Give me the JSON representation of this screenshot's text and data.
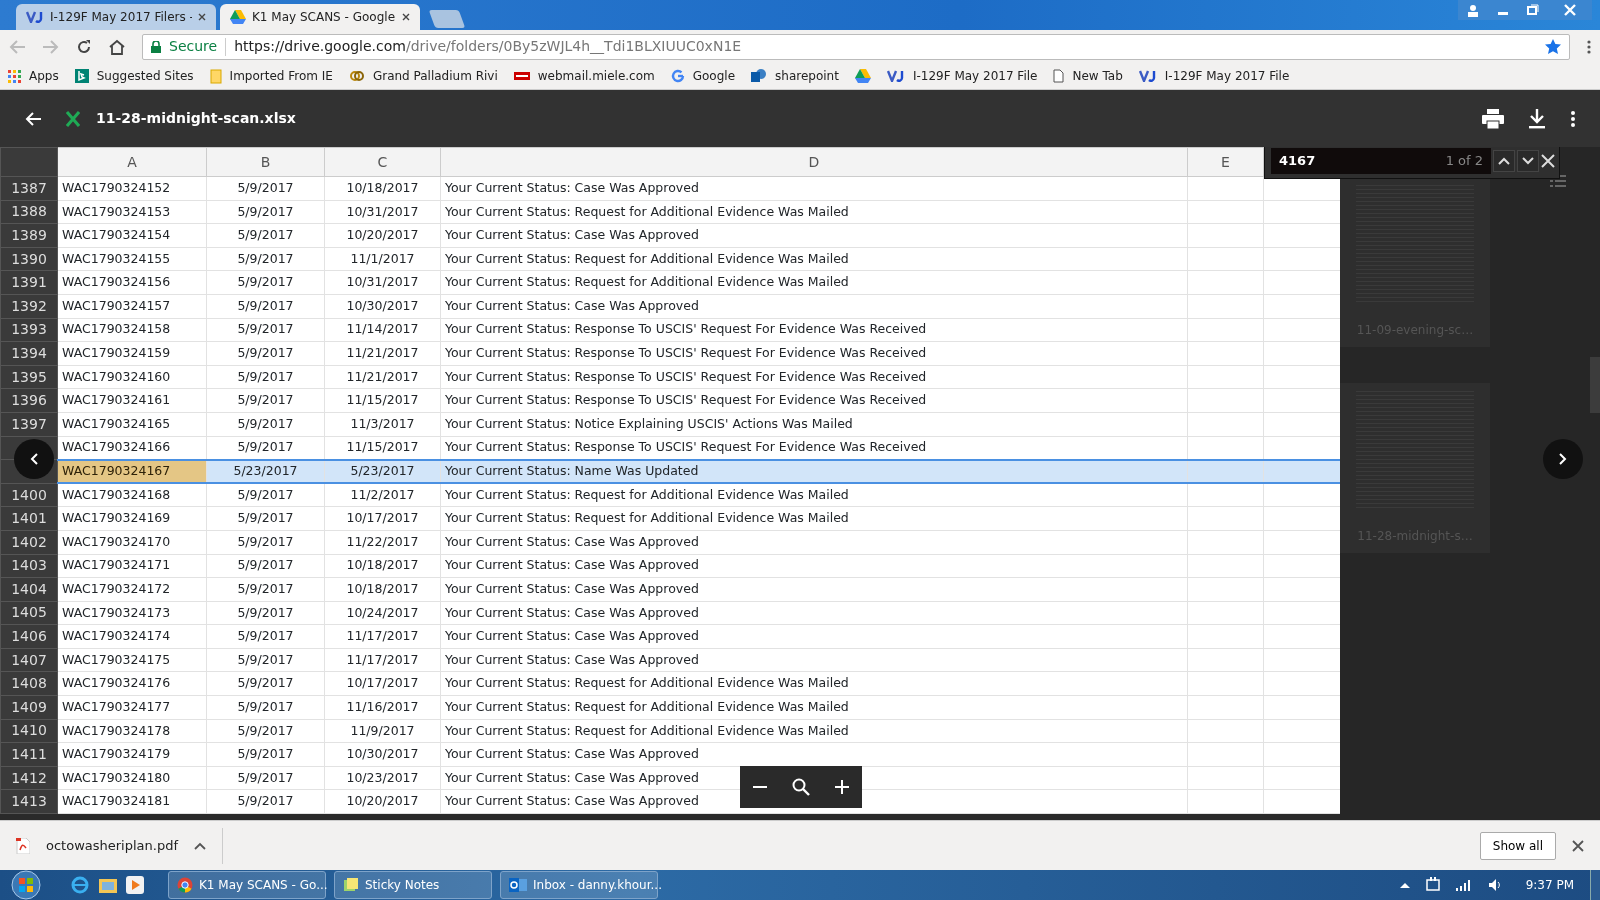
{
  "browser": {
    "tabs": [
      {
        "title": "I-129F May 2017 Filers -",
        "kind": "vj",
        "selected": false
      },
      {
        "title": "K1 May SCANS - Google",
        "kind": "drive",
        "selected": true
      }
    ],
    "secure_label": "Secure",
    "url_host": "https://drive.google.com",
    "url_path": "/drive/folders/0By5zWJL4h__Tdi1BLXIUUC0xN1E",
    "bookmarks": [
      {
        "label": "Apps",
        "kind": "apps"
      },
      {
        "label": "Suggested Sites",
        "kind": "bing"
      },
      {
        "label": "Imported From IE",
        "kind": "folder"
      },
      {
        "label": "Grand Palladium Rivi",
        "kind": "rings"
      },
      {
        "label": "webmail.miele.com",
        "kind": "miele"
      },
      {
        "label": "Google",
        "kind": "google"
      },
      {
        "label": "sharepoint",
        "kind": "sp"
      },
      {
        "kind": "drive"
      },
      {
        "label": "I-129F May 2017 File",
        "kind": "vj"
      },
      {
        "label": "New Tab",
        "kind": "page"
      },
      {
        "label": "I-129F May 2017 File",
        "kind": "vj"
      }
    ]
  },
  "viewer": {
    "file_name": "11-28-midnight-scan.xlsx",
    "find": {
      "query": "4167",
      "count": "1 of 2"
    },
    "thumbnails": [
      {
        "caption": "11-09-evening-sc…"
      },
      {
        "caption": "11-28-midnight-s…"
      }
    ]
  },
  "sheet": {
    "columns": [
      "A",
      "B",
      "C",
      "D",
      "E"
    ],
    "rows": [
      {
        "num": "1387",
        "a": "WAC1790324152",
        "b": "5/9/2017",
        "c": "10/18/2017",
        "d": "Your Current Status: Case Was Approved",
        "selected": false,
        "match": false
      },
      {
        "num": "1388",
        "a": "WAC1790324153",
        "b": "5/9/2017",
        "c": "10/31/2017",
        "d": "Your Current Status: Request for Additional Evidence Was Mailed",
        "selected": false,
        "match": false
      },
      {
        "num": "1389",
        "a": "WAC1790324154",
        "b": "5/9/2017",
        "c": "10/20/2017",
        "d": "Your Current Status: Case Was Approved",
        "selected": false,
        "match": false
      },
      {
        "num": "1390",
        "a": "WAC1790324155",
        "b": "5/9/2017",
        "c": "11/1/2017",
        "d": "Your Current Status: Request for Additional Evidence Was Mailed",
        "selected": false,
        "match": false
      },
      {
        "num": "1391",
        "a": "WAC1790324156",
        "b": "5/9/2017",
        "c": "10/31/2017",
        "d": "Your Current Status: Request for Additional Evidence Was Mailed",
        "selected": false,
        "match": false
      },
      {
        "num": "1392",
        "a": "WAC1790324157",
        "b": "5/9/2017",
        "c": "10/30/2017",
        "d": "Your Current Status: Case Was Approved",
        "selected": false,
        "match": false
      },
      {
        "num": "1393",
        "a": "WAC1790324158",
        "b": "5/9/2017",
        "c": "11/14/2017",
        "d": "Your Current Status: Response To USCIS' Request For Evidence Was Received",
        "selected": false,
        "match": false
      },
      {
        "num": "1394",
        "a": "WAC1790324159",
        "b": "5/9/2017",
        "c": "11/21/2017",
        "d": "Your Current Status: Response To USCIS' Request For Evidence Was Received",
        "selected": false,
        "match": false
      },
      {
        "num": "1395",
        "a": "WAC1790324160",
        "b": "5/9/2017",
        "c": "11/21/2017",
        "d": "Your Current Status: Response To USCIS' Request For Evidence Was Received",
        "selected": false,
        "match": false
      },
      {
        "num": "1396",
        "a": "WAC1790324161",
        "b": "5/9/2017",
        "c": "11/15/2017",
        "d": "Your Current Status: Response To USCIS' Request For Evidence Was Received",
        "selected": false,
        "match": false
      },
      {
        "num": "1397",
        "a": "WAC1790324165",
        "b": "5/9/2017",
        "c": "11/3/2017",
        "d": "Your Current Status: Notice Explaining USCIS' Actions Was Mailed",
        "selected": false,
        "match": false
      },
      {
        "a": "WAC1790324166",
        "b": "5/9/2017",
        "c": "11/15/2017",
        "d": "Your Current Status: Response To USCIS' Request For Evidence Was Received",
        "selected": false,
        "match": false
      },
      {
        "a": "WAC1790324167",
        "b": "5/23/2017",
        "c": "5/23/2017",
        "d": "Your Current Status: Name Was Updated",
        "selected": true,
        "match": true
      },
      {
        "num": "1400",
        "a": "WAC1790324168",
        "b": "5/9/2017",
        "c": "11/2/2017",
        "d": "Your Current Status: Request for Additional Evidence Was Mailed",
        "selected": false,
        "match": false
      },
      {
        "num": "1401",
        "a": "WAC1790324169",
        "b": "5/9/2017",
        "c": "10/17/2017",
        "d": "Your Current Status: Request for Additional Evidence Was Mailed",
        "selected": false,
        "match": false
      },
      {
        "num": "1402",
        "a": "WAC1790324170",
        "b": "5/9/2017",
        "c": "11/22/2017",
        "d": "Your Current Status: Case Was Approved",
        "selected": false,
        "match": false
      },
      {
        "num": "1403",
        "a": "WAC1790324171",
        "b": "5/9/2017",
        "c": "10/18/2017",
        "d": "Your Current Status: Case Was Approved",
        "selected": false,
        "match": false
      },
      {
        "num": "1404",
        "a": "WAC1790324172",
        "b": "5/9/2017",
        "c": "10/18/2017",
        "d": "Your Current Status: Case Was Approved",
        "selected": false,
        "match": false
      },
      {
        "num": "1405",
        "a": "WAC1790324173",
        "b": "5/9/2017",
        "c": "10/24/2017",
        "d": "Your Current Status: Case Was Approved",
        "selected": false,
        "match": false
      },
      {
        "num": "1406",
        "a": "WAC1790324174",
        "b": "5/9/2017",
        "c": "11/17/2017",
        "d": "Your Current Status: Case Was Approved",
        "selected": false,
        "match": false
      },
      {
        "num": "1407",
        "a": "WAC1790324175",
        "b": "5/9/2017",
        "c": "11/17/2017",
        "d": "Your Current Status: Case Was Approved",
        "selected": false,
        "match": false
      },
      {
        "num": "1408",
        "a": "WAC1790324176",
        "b": "5/9/2017",
        "c": "10/17/2017",
        "d": "Your Current Status: Request for Additional Evidence Was Mailed",
        "selected": false,
        "match": false
      },
      {
        "num": "1409",
        "a": "WAC1790324177",
        "b": "5/9/2017",
        "c": "11/16/2017",
        "d": "Your Current Status: Request for Additional Evidence Was Mailed",
        "selected": false,
        "match": false
      },
      {
        "num": "1410",
        "a": "WAC1790324178",
        "b": "5/9/2017",
        "c": "11/9/2017",
        "d": "Your Current Status: Request for Additional Evidence Was Mailed",
        "selected": false,
        "match": false
      },
      {
        "num": "1411",
        "a": "WAC1790324179",
        "b": "5/9/2017",
        "c": "10/30/2017",
        "d": "Your Current Status: Case Was Approved",
        "selected": false,
        "match": false
      },
      {
        "num": "1412",
        "a": "WAC1790324180",
        "b": "5/9/2017",
        "c": "10/23/2017",
        "d": "Your Current Status: Case Was Approved",
        "selected": false,
        "match": false
      },
      {
        "num": "1413",
        "a": "WAC1790324181",
        "b": "5/9/2017",
        "c": "10/20/2017",
        "d": "Your Current Status: Case Was Approved",
        "selected": false,
        "match": false
      }
    ]
  },
  "download_bar": {
    "file": "octowasheriplan.pdf",
    "show_all": "Show all"
  },
  "taskbar": {
    "items": [
      {
        "label": "K1 May SCANS - Go...",
        "kind": "chrome"
      },
      {
        "label": "Sticky Notes",
        "kind": "notes"
      },
      {
        "label": "Inbox - danny.khour...",
        "kind": "outlook"
      }
    ],
    "clock": "9:37 PM"
  }
}
